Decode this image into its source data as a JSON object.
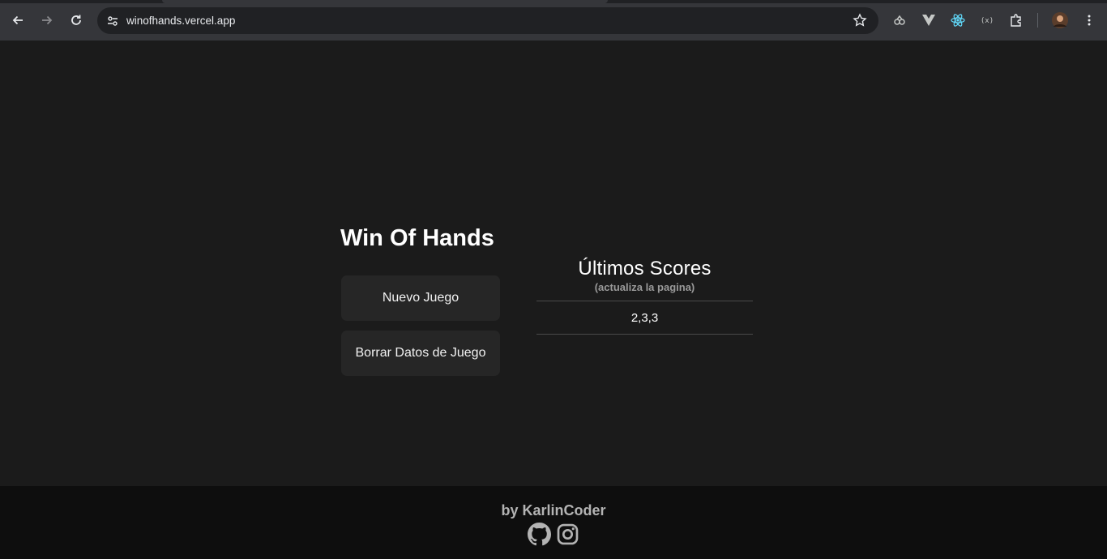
{
  "browser": {
    "url": "winofhands.vercel.app"
  },
  "app": {
    "title": "Win Of Hands",
    "buttons": {
      "new_game": "Nuevo Juego",
      "clear_data": "Borrar Datos de Juego"
    },
    "scores": {
      "heading": "Últimos Scores",
      "subheading": "(actualiza la pagina)",
      "rows": [
        "2,3,3"
      ]
    }
  },
  "footer": {
    "credit": "by KarlinCoder",
    "icons": [
      "github-icon",
      "instagram-icon"
    ]
  },
  "colors": {
    "background": "#1b1b1b",
    "button": "#262626",
    "footer": "#0e0e0e"
  }
}
